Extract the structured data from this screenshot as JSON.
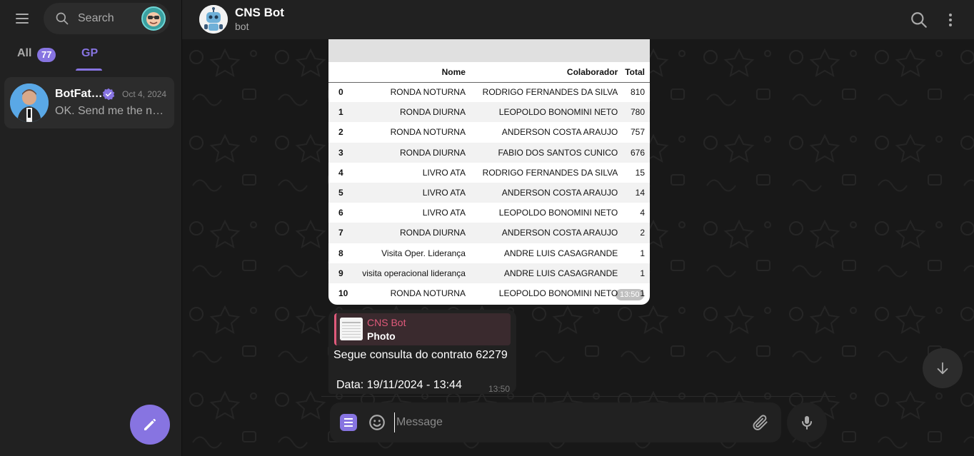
{
  "sidebar": {
    "search_placeholder": "Search",
    "tabs": [
      {
        "label": "All",
        "count": "77"
      },
      {
        "label": "GP"
      }
    ],
    "chats": [
      {
        "name": "BotFat…",
        "date": "Oct 4, 2024",
        "preview": "OK. Send me the ne…",
        "verified": true
      }
    ]
  },
  "header": {
    "title": "CNS Bot",
    "subtitle": "bot"
  },
  "table": {
    "columns": [
      "",
      "Nome",
      "Colaborador",
      "Total"
    ],
    "rows": [
      [
        "0",
        "RONDA NOTURNA",
        "RODRIGO FERNANDES DA SILVA",
        "810"
      ],
      [
        "1",
        "RONDA DIURNA",
        "LEOPOLDO BONOMINI NETO",
        "780"
      ],
      [
        "2",
        "RONDA NOTURNA",
        "ANDERSON COSTA ARAUJO",
        "757"
      ],
      [
        "3",
        "RONDA DIURNA",
        "FABIO DOS SANTOS CUNICO",
        "676"
      ],
      [
        "4",
        "LIVRO ATA",
        "RODRIGO FERNANDES DA SILVA",
        "15"
      ],
      [
        "5",
        "LIVRO ATA",
        "ANDERSON COSTA ARAUJO",
        "14"
      ],
      [
        "6",
        "LIVRO ATA",
        "LEOPOLDO BONOMINI NETO",
        "4"
      ],
      [
        "7",
        "RONDA DIURNA",
        "ANDERSON COSTA ARAUJO",
        "2"
      ],
      [
        "8",
        "Visita Oper. Liderança",
        "ANDRE LUIS CASAGRANDE",
        "1"
      ],
      [
        "9",
        "visita operacional liderança",
        "ANDRE LUIS CASAGRANDE",
        "1"
      ],
      [
        "10",
        "RONDA NOTURNA",
        "LEOPOLDO BONOMINI NETO",
        "1"
      ]
    ],
    "time": "13:50"
  },
  "message": {
    "reply_name": "CNS Bot",
    "reply_label": "Photo",
    "line1": "Segue consulta do contrato 62279",
    "line2": "Data: 19/11/2024 - 13:44",
    "time": "13:50"
  },
  "composer": {
    "placeholder": "Message"
  },
  "colors": {
    "accent": "#8774e1",
    "background": "#181818",
    "panel": "#212121",
    "reply_accent": "#e05a7b"
  }
}
